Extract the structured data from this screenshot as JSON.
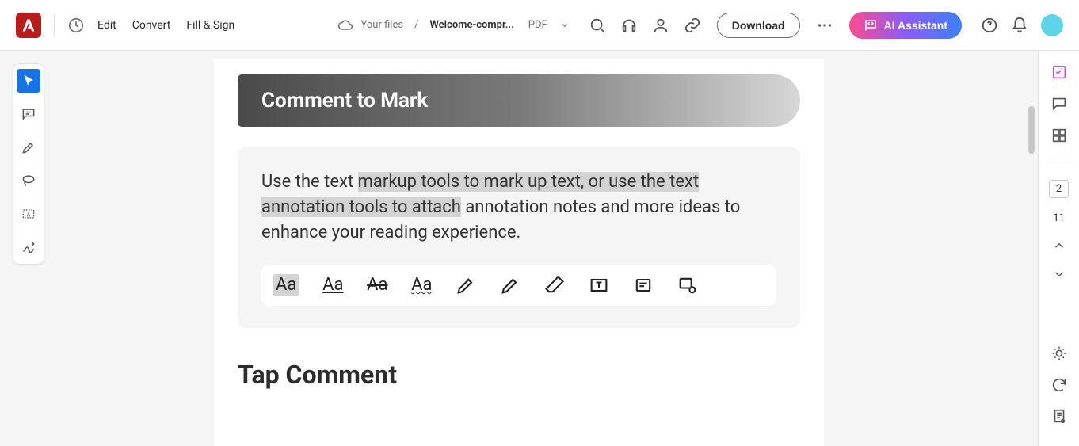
{
  "topbar": {
    "menu": {
      "edit": "Edit",
      "convert": "Convert",
      "fillsign": "Fill & Sign"
    },
    "breadcrumb": {
      "root": "Your files",
      "filename": "Welcome-compr...",
      "filetype": "PDF"
    },
    "download": "Download",
    "ai": "AI Assistant"
  },
  "doc": {
    "banner": "Comment to Mark",
    "body_pre": "Use the text ",
    "body_hl": "markup tools to mark up text, or use the text annotation tools to attach",
    "body_post": " annotation notes and more ideas to enhance your reading experience.",
    "tool_aa": "Aa",
    "heading2": "Tap Comment"
  },
  "pages": {
    "current": "2",
    "total": "11"
  }
}
